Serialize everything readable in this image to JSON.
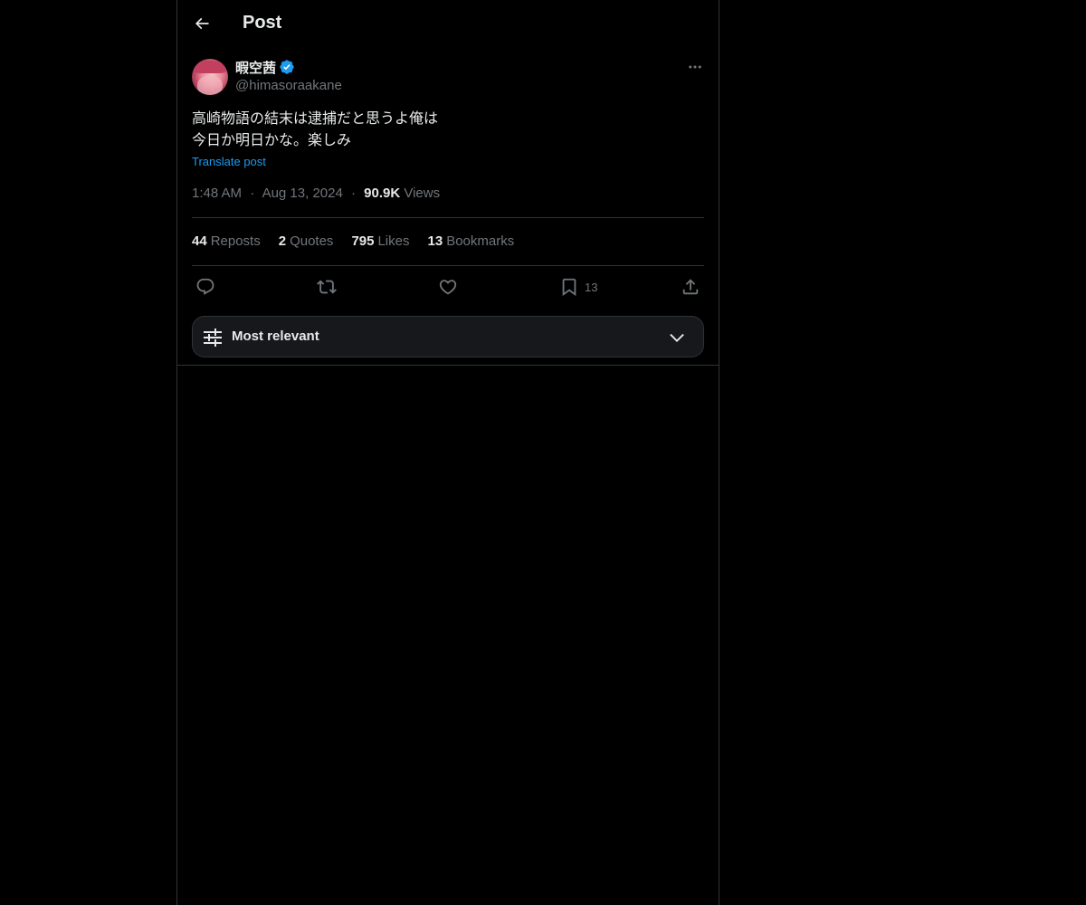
{
  "header": {
    "title": "Post"
  },
  "post": {
    "author": {
      "display_name": "暇空茜",
      "handle": "@himasoraakane",
      "verified": true
    },
    "text_lines": [
      "高崎物語の結末は逮捕だと思うよ俺は",
      "今日か明日かな。楽しみ"
    ],
    "translate_label": "Translate post",
    "time": "1:48 AM",
    "date": "Aug 13, 2024",
    "separator": "·",
    "views_count": "90.9K",
    "views_label": "Views"
  },
  "stats": [
    {
      "count": "44",
      "label": "Reposts"
    },
    {
      "count": "2",
      "label": "Quotes"
    },
    {
      "count": "795",
      "label": "Likes"
    },
    {
      "count": "13",
      "label": "Bookmarks"
    }
  ],
  "actions": {
    "reply_icon": "reply-icon",
    "repost_icon": "repost-icon",
    "like_icon": "heart-icon",
    "bookmark_icon": "bookmark-icon",
    "bookmark_count": "13",
    "share_icon": "share-icon"
  },
  "sort": {
    "label": "Most relevant"
  },
  "colors": {
    "background": "#000000",
    "text": "#e7e9ea",
    "muted": "#71767b",
    "accent": "#1d9bf0",
    "border": "#2f3336",
    "verified": "#1d9bf0"
  }
}
